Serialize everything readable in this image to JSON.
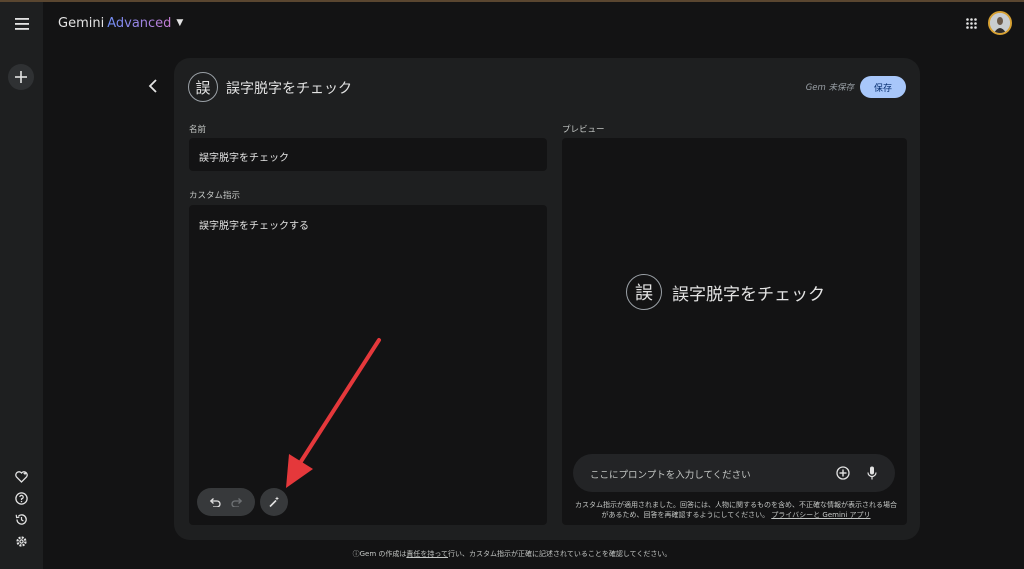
{
  "header": {
    "brand": "Gemini",
    "tier": "Advanced"
  },
  "rail": {
    "icons": [
      "menu-icon",
      "plus-icon",
      "gem-heart-icon",
      "help-icon",
      "history-icon",
      "settings-icon"
    ]
  },
  "editor": {
    "gem_icon_char": "誤",
    "gem_title": "誤字脱字をチェック",
    "unsaved_status": "Gem 未保存",
    "save_label": "保存",
    "name_label": "名前",
    "name_value": "誤字脱字をチェック",
    "instructions_label": "カスタム指示",
    "instructions_value": "誤字脱字をチェックする"
  },
  "preview": {
    "label": "プレビュー",
    "gem_icon_char": "誤",
    "gem_title": "誤字脱字をチェック",
    "prompt_placeholder": "ここにプロンプトを入力してください",
    "disclaimer_text": "カスタム指示が適用されました。回答には、人物に関するものを含め、不正確な情報が表示される場合があるため、回答を再確認するようにしてください。",
    "disclaimer_link": "プライバシーと Gemini アプリ"
  },
  "footer": {
    "prefix": "ⓘGem の作成は",
    "link": "責任を持って",
    "suffix": "行い、カスタム指示が正確に記述されていることを確認してください。"
  },
  "colors": {
    "background": "#131314",
    "surface": "#1e1f20",
    "save_button": "#a8c7fa",
    "annotation_arrow": "#e5383b"
  }
}
